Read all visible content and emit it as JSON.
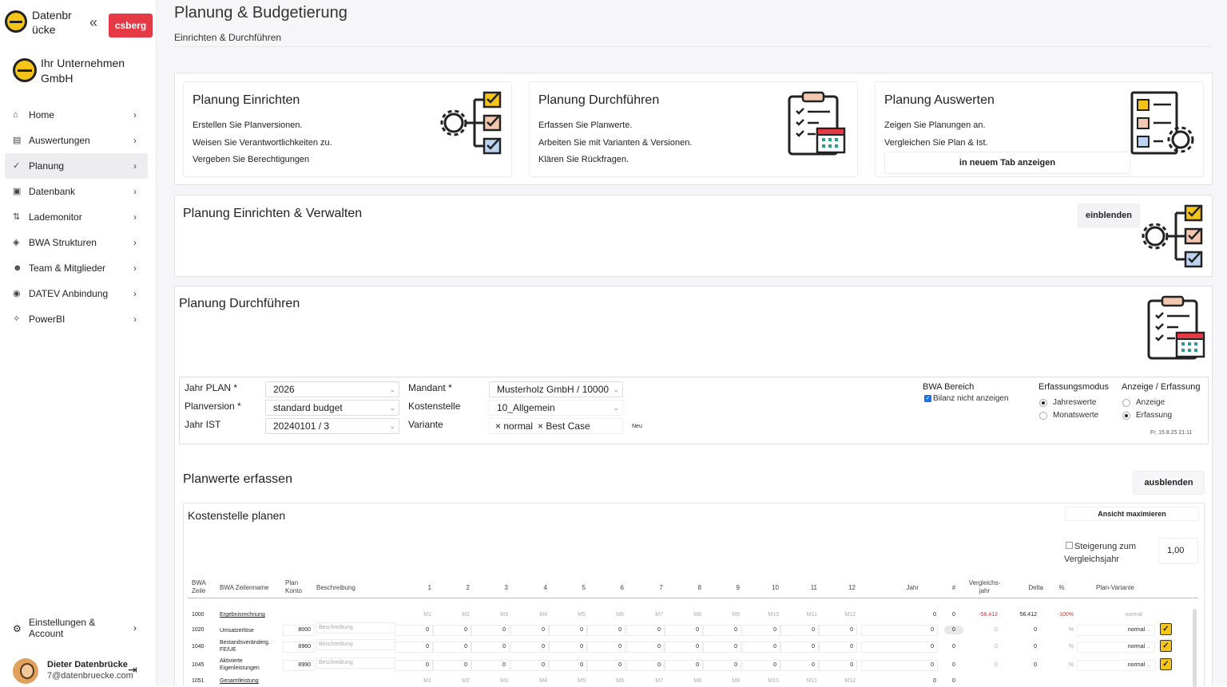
{
  "brand": {
    "name": "Datenbrücke",
    "name_line1": "Datenbr",
    "name_line2": "ücke",
    "tenant": "csberg",
    "company_line1": "Ihr Unternehmen",
    "company_line2": "GmbH",
    "collapse_icon": "«"
  },
  "nav": [
    {
      "label": "Home",
      "icon": "home-icon"
    },
    {
      "label": "Auswertungen",
      "icon": "chart-icon"
    },
    {
      "label": "Planung",
      "icon": "check-icon",
      "active": true
    },
    {
      "label": "Datenbank",
      "icon": "database-icon"
    },
    {
      "label": "Lademonitor",
      "icon": "monitor-icon"
    },
    {
      "label": "BWA Strukturen",
      "icon": "layers-icon"
    },
    {
      "label": "Team & Mitglieder",
      "icon": "team-icon"
    },
    {
      "label": "DATEV Anbindung",
      "icon": "link-icon"
    },
    {
      "label": "PowerBI",
      "icon": "powerbi-icon"
    }
  ],
  "settings": {
    "line1": "Einstellungen &",
    "line2": "Account"
  },
  "user": {
    "name": "Dieter Datenbrücke",
    "email": "7@datenbruecke.com"
  },
  "page": {
    "title": "Planung & Budgetierung",
    "subtitle": "Einrichten & Durchführen"
  },
  "cards": [
    {
      "title": "Planung Einrichten",
      "lines": [
        "Erstellen Sie Planversionen.",
        "Weisen Sie Verantwortlichkeiten zu.",
        "Vergeben Sie Berechtigungen"
      ]
    },
    {
      "title": "Planung Durchführen",
      "lines": [
        "Erfassen Sie Planwerte.",
        "Arbeiten Sie mit Varianten & Versionen.",
        "Klären Sie Rückfragen."
      ]
    },
    {
      "title": "Planung Auswerten",
      "lines": [
        "Zeigen Sie Planungen an.",
        "Vergleichen Sie Plan & Ist."
      ],
      "button": "in neuem Tab anzeigen"
    }
  ],
  "setup": {
    "title": "Planung Einrichten & Verwalten",
    "button": "einblenden"
  },
  "execute": {
    "title": "Planung Durchführen"
  },
  "filters": {
    "jahr_plan_label": "Jahr PLAN *",
    "jahr_plan": "2026",
    "planversion_label": "Planversion *",
    "planversion": "standard budget",
    "jahr_ist_label": "Jahr IST",
    "jahr_ist": "20240101 / 3",
    "mandant_label": "Mandant *",
    "mandant": "Musterholz GmbH / 10000",
    "kostenstelle_label": "Kostenstelle",
    "kostenstelle": "10_Allgemein",
    "variante_label": "Variante",
    "varianten": [
      "normal",
      "Best Case"
    ],
    "neu": "Neu",
    "bwa_label": "BWA Bereich",
    "bilanz": "Bilanz nicht anzeigen",
    "modus_label": "Erfassungsmodus",
    "modus_jahr": "Jahreswerte",
    "modus_monat": "Monatswerte",
    "anzeige_label": "Anzeige / Erfassung",
    "anzeige": "Anzeige",
    "erfassung": "Erfassung",
    "timestamp": "Fr, 15.8.25  21:11"
  },
  "planwerte": {
    "title": "Planwerte erfassen",
    "button": "ausblenden"
  },
  "kst": {
    "title": "Kostenstelle planen",
    "maximize": "Ansicht maximieren",
    "steigerung_line1": "Steigerung zum",
    "steigerung_line2": "Vergleichsjahr",
    "factor": "1,00"
  },
  "table": {
    "headers": {
      "bwa_zeile_1": "BWA",
      "bwa_zeile_2": "Zeile",
      "zeilenname": "BWA Zeilenname",
      "plan_konto_1": "Plan",
      "plan_konto_2": "Konto",
      "beschreibung": "Beschreibung",
      "m1": "1",
      "m2": "2",
      "m3": "3",
      "m4": "4",
      "m5": "5",
      "m6": "6",
      "m7": "7",
      "m8": "8",
      "m9": "9",
      "m10": "10",
      "m11": "11",
      "m12": "12",
      "jahr": "Jahr",
      "hash": "#",
      "vgl_1": "Vergleichs-",
      "vgl_2": "jahr",
      "delta": "Delta",
      "pct": "%",
      "variante": "Plan-Variante"
    },
    "placeholder": "Beschreibung",
    "rows": [
      {
        "zeile": "1000",
        "name": "Ergebnisrechnung",
        "konto": "",
        "months": [
          "M1",
          "M2",
          "M3",
          "M4",
          "M5",
          "M6",
          "M7",
          "M8",
          "M9",
          "M10",
          "M11",
          "M12"
        ],
        "jahr": "0",
        "hash": "0",
        "vgl": "-56.412",
        "delta": "56.412",
        "pct": "-100%",
        "variante": "normal",
        "header": true
      },
      {
        "zeile": "1020",
        "name": "Umsatzerlöse",
        "konto": "8000",
        "months": [
          "0",
          "0",
          "0",
          "0",
          "0",
          "0",
          "0",
          "0",
          "0",
          "0",
          "0",
          "0"
        ],
        "jahr": "0",
        "hash": "0",
        "vgl": "0",
        "delta": "0",
        "pct": "%",
        "variante": "normal"
      },
      {
        "zeile": "1040",
        "name": "Bestandsveränderg. FE/UE",
        "name1": "Bestandsveränderg.",
        "name2": "FE/UE",
        "konto": "8960",
        "months": [
          "0",
          "0",
          "0",
          "0",
          "0",
          "0",
          "0",
          "0",
          "0",
          "0",
          "0",
          "0"
        ],
        "jahr": "0",
        "hash": "0",
        "vgl": "0",
        "delta": "0",
        "pct": "%",
        "variante": "normal"
      },
      {
        "zeile": "1045",
        "name": "Aktivierte Eigenleistungen",
        "name1": "Aktivierte",
        "name2": "Eigenleistungen",
        "konto": "8990",
        "months": [
          "0",
          "0",
          "0",
          "0",
          "0",
          "0",
          "0",
          "0",
          "0",
          "0",
          "0",
          "0"
        ],
        "jahr": "0",
        "hash": "0",
        "vgl": "0",
        "delta": "0",
        "pct": "%",
        "variante": "normal"
      },
      {
        "zeile": "1051",
        "name": "Gesamtleistung",
        "konto": "",
        "months": [
          "M1",
          "M2",
          "M3",
          "M4",
          "M5",
          "M6",
          "M7",
          "M8",
          "M9",
          "M10",
          "M11",
          "M12"
        ],
        "jahr": "0",
        "hash": "0",
        "vgl": "",
        "delta": "",
        "pct": "",
        "variante": "",
        "header": true
      }
    ]
  }
}
